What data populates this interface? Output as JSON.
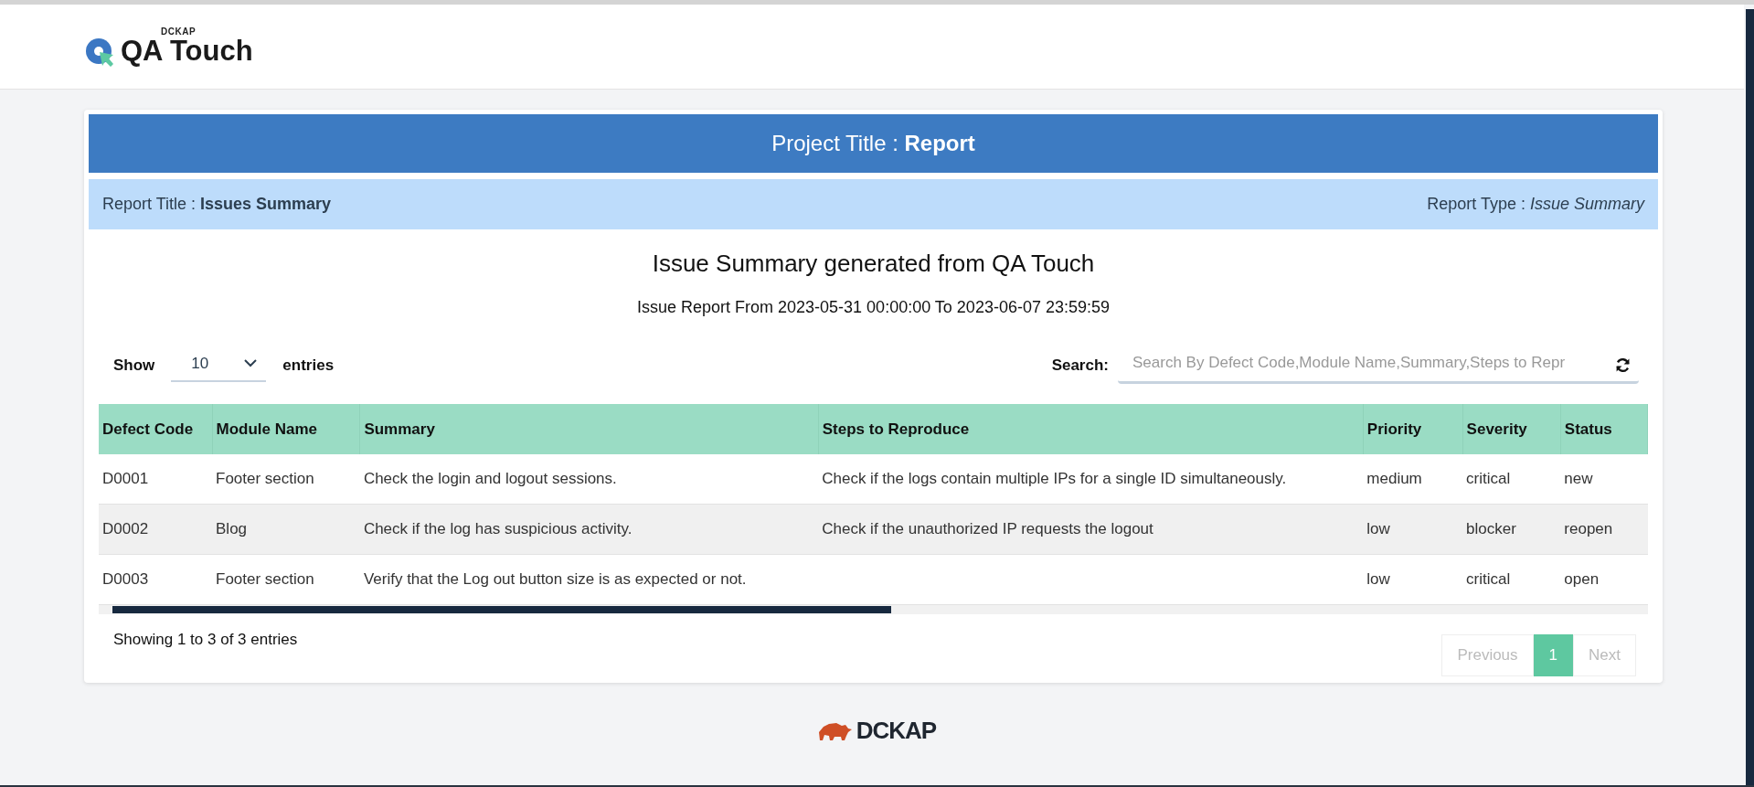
{
  "logo": {
    "brand": "DCKAP",
    "name": "QA Touch"
  },
  "project_header": "Project Title : **Report**",
  "report_bar": {
    "title": "Report Title : **Issues Summary**",
    "type": "Report Type : *Issue Summary*"
  },
  "heading": "Issue Summary generated from QA Touch",
  "subheading": "Issue Report From 2023-05-31 00:00:00 To 2023-06-07 23:59:59",
  "length_control": {
    "before": "Show",
    "value": "10",
    "after": "entries"
  },
  "search": {
    "label": "Search:",
    "placeholder": "Search By Defect Code,Module Name,Summary,Steps to Repr"
  },
  "table": {
    "columns": [
      "Defect Code",
      "Module Name",
      "Summary",
      "Steps to Reproduce",
      "Priority",
      "Severity",
      "Status"
    ],
    "rows": [
      [
        "D0001",
        "Footer section",
        "Check the login and logout sessions.",
        "Check if the logs contain multiple IPs for a single ID simultaneously.",
        "medium",
        "critical",
        "new"
      ],
      [
        "D0002",
        "Blog",
        "Check if the log has suspicious activity.",
        "Check if the unauthorized IP requests the logout",
        "low",
        "blocker",
        "reopen"
      ],
      [
        "D0003",
        "Footer section",
        "Verify that the Log out button size is as expected or not.",
        "",
        "low",
        "critical",
        "open"
      ]
    ]
  },
  "info": "Showing 1 to 3 of 3 entries",
  "pagination": [
    {
      "label": "Previous",
      "selected": false,
      "disabled": true
    },
    {
      "label": "1",
      "selected": true,
      "disabled": false
    },
    {
      "label": "Next",
      "selected": false,
      "disabled": true
    }
  ],
  "footer": {
    "brand": "DCKAP"
  }
}
